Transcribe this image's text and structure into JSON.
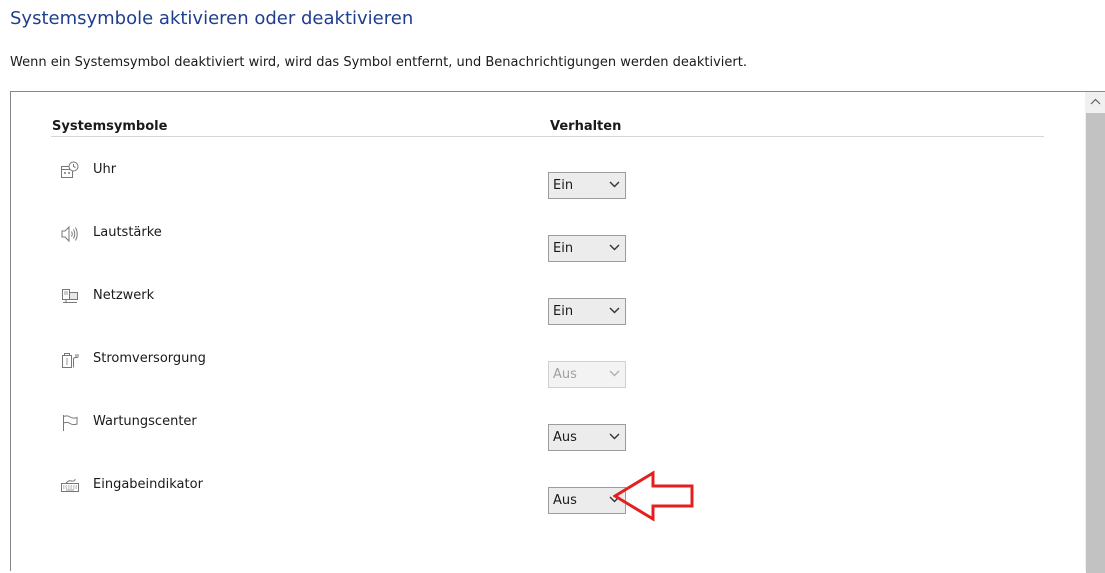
{
  "header": {
    "title": "Systemsymbole aktivieren oder deaktivieren",
    "description": "Wenn ein Systemsymbol deaktiviert wird, wird das Symbol entfernt, und Benachrichtigungen werden deaktiviert."
  },
  "table": {
    "col_symbols": "Systemsymbole",
    "col_behavior": "Verhalten",
    "rows": [
      {
        "label": "Uhr",
        "value": "Ein",
        "icon": "clock-icon",
        "enabled": true
      },
      {
        "label": "Lautstärke",
        "value": "Ein",
        "icon": "speaker-icon",
        "enabled": true
      },
      {
        "label": "Netzwerk",
        "value": "Ein",
        "icon": "network-icon",
        "enabled": true
      },
      {
        "label": "Stromversorgung",
        "value": "Aus",
        "icon": "power-plug-icon",
        "enabled": false
      },
      {
        "label": "Wartungscenter",
        "value": "Aus",
        "icon": "flag-icon",
        "enabled": true
      },
      {
        "label": "Eingabeindikator",
        "value": "Aus",
        "icon": "keyboard-icon",
        "enabled": true
      }
    ]
  },
  "colors": {
    "title": "#1e3e8f",
    "annotation_arrow": "#e32020"
  }
}
